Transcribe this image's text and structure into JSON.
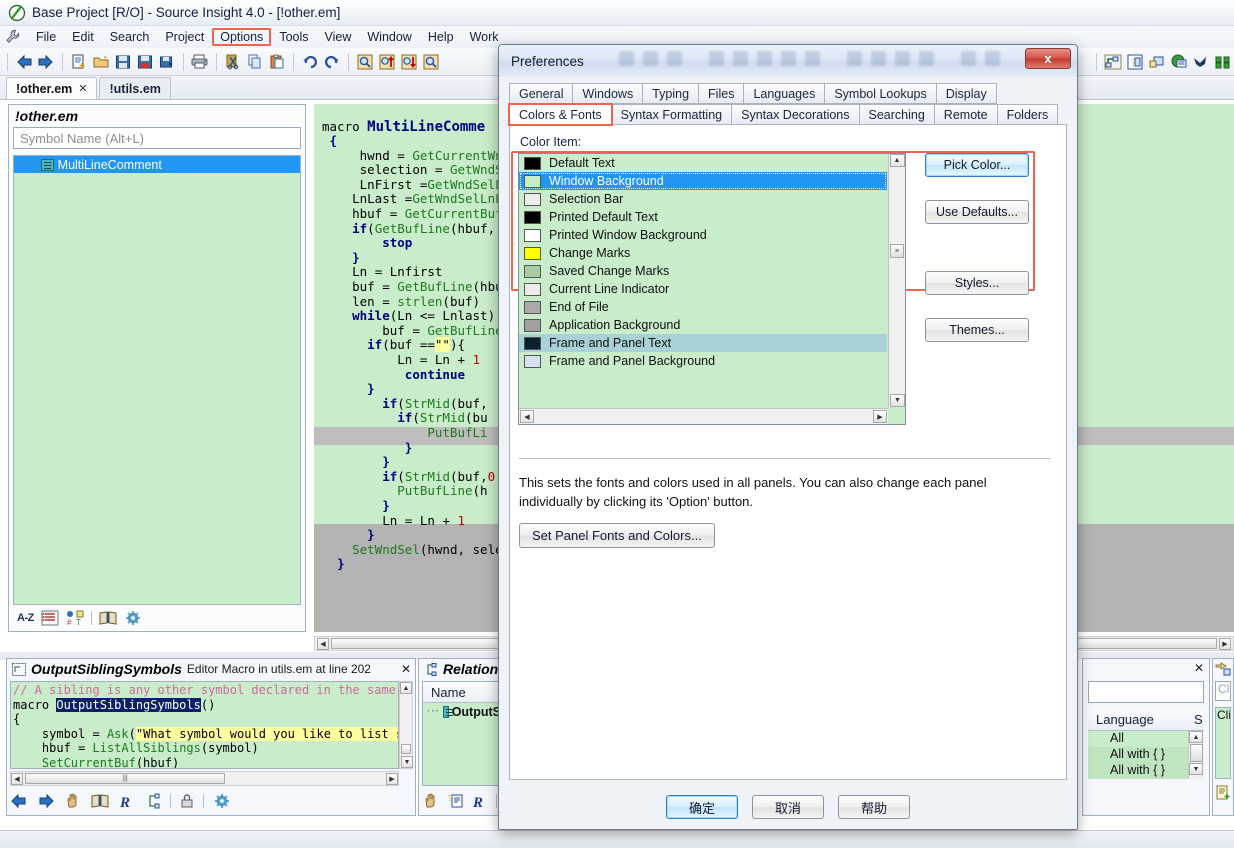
{
  "window": {
    "title": "Base Project [R/O] - Source Insight 4.0 - [!other.em]",
    "app_icon": "source-insight-icon"
  },
  "menubar": {
    "items": [
      "File",
      "Edit",
      "Search",
      "Project",
      "Options",
      "Tools",
      "View",
      "Window",
      "Help",
      "Work"
    ],
    "highlighted": "Options"
  },
  "toolbar": {
    "icons": [
      "back-arrow-icon",
      "forward-arrow-icon",
      "new-file-icon",
      "open-folder-icon",
      "save-icon",
      "save-all-icon",
      "save-as-icon",
      "print-icon",
      "cut-icon",
      "copy-icon",
      "paste-icon",
      "undo-icon",
      "redo-icon",
      "search-icon",
      "search-up-icon",
      "search-down-icon",
      "search-files-icon"
    ],
    "right_icons": [
      "relation-window-icon",
      "symbol-info-icon",
      "context-window-icon",
      "browse-web-icon",
      "bird-icon",
      "compare-icon"
    ]
  },
  "doc_tabs": [
    {
      "label": "!other.em",
      "active": true,
      "close": "✕"
    },
    {
      "label": "!utils.em",
      "active": false
    }
  ],
  "symbol_panel": {
    "header": "!other.em",
    "search_placeholder": "Symbol Name (Alt+L)",
    "items": [
      {
        "label": "MultiLineComment",
        "selected": true,
        "icon": "macro-symbol-icon"
      }
    ],
    "footer_label": "A-Z",
    "footer_icons": [
      "list-view-icon",
      "sort-type-icon",
      "book-icon",
      "gear-icon"
    ]
  },
  "editor": {
    "lines": [
      "macro MultiLineComme",
      "{",
      "    hwnd = GetCurrentWnd",
      "    selection = GetWndSe",
      "    LnFirst =GetWndSelLn",
      "   LnLast =GetWndSelLnL",
      "   hbuf = GetCurrentBuf",
      "   if(GetBufLine(hbuf,",
      "       stop",
      "   }",
      "   Ln = Lnfirst",
      "   buf = GetBufLine(hbu",
      "   len = strlen(buf)",
      "   while(Ln <= Lnlast)",
      "       buf = GetBufLine",
      "     if(buf ==\"\"){",
      "         Ln = Ln + 1",
      "          continue",
      "     }",
      "       if(StrMid(buf,",
      "         if(StrMid(bu",
      "             PutBufLi",
      "          }",
      "       }",
      "       if(StrMid(buf,0",
      "         PutBufLine(h",
      "       }",
      "       Ln = Ln + 1",
      "     }",
      "   SetWndSel(hwnd, sele",
      " }"
    ]
  },
  "macro_panel": {
    "title": "OutputSiblingSymbols",
    "subtitle": "Editor Macro in utils.em at line 202",
    "close": "✕",
    "icon": "relation-icon",
    "code_lines": [
      "// A sibling is any other symbol declared in the same",
      "macro OutputSiblingSymbols()",
      "{",
      "    symbol = Ask(\"What symbol would you like to list s",
      "    hbuf = ListAllSiblings(symbol)",
      "    SetCurrentBuf(hbuf)",
      "}"
    ],
    "highlighted_symbol": "OutputSiblingSymbols",
    "footer_icons": [
      "back-arrow-icon",
      "forward-arrow-icon",
      "hand-icon",
      "book-icon",
      "r-icon",
      "relation-icon",
      "lock-icon",
      "gear-icon"
    ]
  },
  "relation_panel": {
    "title": "Relation",
    "column_header": "Name",
    "rows": [
      {
        "label": "OutputS",
        "icon": "macro-symbol-icon"
      }
    ],
    "footer_icons": [
      "hand-icon",
      "symbol-info-icon",
      "r-icon"
    ]
  },
  "right_panel": {
    "close": "✕",
    "search_value": "",
    "columns": [
      "Language",
      "S"
    ],
    "rows": [
      "All",
      "All with { }",
      "All with { }"
    ]
  },
  "clip_panel": {
    "icon": "clip-window-icon",
    "placeholder": "Cli",
    "label": "Clip",
    "footer_icon": "new-clip-icon"
  },
  "dialog": {
    "title": "Preferences",
    "close_label": "x",
    "tabs_row1": [
      "General",
      "Windows",
      "Typing",
      "Files",
      "Languages",
      "Symbol Lookups",
      "Display"
    ],
    "tabs_row2": [
      "Colors & Fonts",
      "Syntax Formatting",
      "Syntax Decorations",
      "Searching",
      "Remote",
      "Folders"
    ],
    "selected_tab": "Colors & Fonts",
    "color_item_label": "Color Item:",
    "color_items": [
      {
        "label": "Default Text",
        "swatch": "#000000",
        "state": "normal"
      },
      {
        "label": "Window Background",
        "swatch": "#c9ecca",
        "state": "selected"
      },
      {
        "label": "Selection Bar",
        "swatch": "#ededed",
        "state": "normal"
      },
      {
        "label": "Printed Default Text",
        "swatch": "#000000",
        "state": "normal"
      },
      {
        "label": "Printed Window Background",
        "swatch": "#ffffff",
        "state": "normal"
      },
      {
        "label": "Change Marks",
        "swatch": "#ffff00",
        "state": "normal"
      },
      {
        "label": "Saved Change Marks",
        "swatch": "#a8cba4",
        "state": "normal"
      },
      {
        "label": "Current Line Indicator",
        "swatch": "#ececec",
        "state": "normal"
      },
      {
        "label": "End of File",
        "swatch": "#a9a9a9",
        "state": "normal"
      },
      {
        "label": "Application Background",
        "swatch": "#a0a0a0",
        "state": "normal"
      },
      {
        "label": "Frame and Panel Text",
        "swatch": "#0d2030",
        "state": "hover"
      },
      {
        "label": "Frame and Panel Background",
        "swatch": "#d6e1ef",
        "state": "normal"
      }
    ],
    "buttons": {
      "pick_color": "Pick Color...",
      "use_defaults": "Use Defaults...",
      "styles": "Styles...",
      "themes": "Themes..."
    },
    "help_text": "This sets the fonts and colors used in all panels. You can also change each panel individually by clicking its 'Option' button.",
    "panel_button": "Set Panel Fonts and Colors...",
    "footer": {
      "ok": "确定",
      "cancel": "取消",
      "help": "帮助"
    }
  },
  "colors": {
    "accent_blue": "#2196f3",
    "highlight_red": "#f0634c",
    "window_bg_green": "#c9ecca",
    "app_bg_gray": "#b3b3b3"
  }
}
